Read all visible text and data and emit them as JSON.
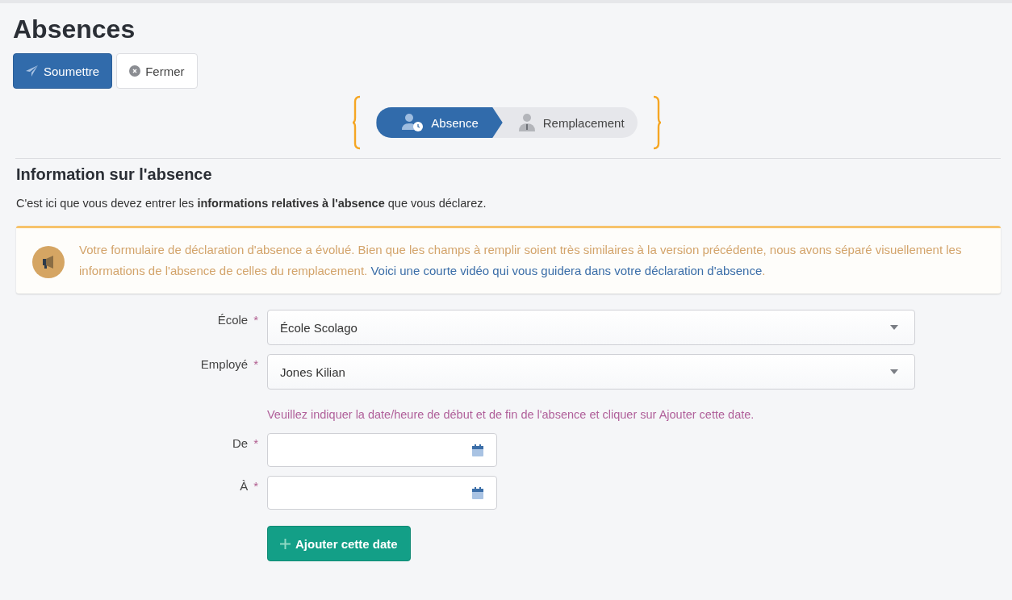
{
  "page": {
    "title": "Absences"
  },
  "toolbar": [
    {
      "label": "Soumettre",
      "kind": "primary"
    },
    {
      "label": "Fermer",
      "kind": "close"
    }
  ],
  "steps": [
    {
      "label": "Absence",
      "selected": true,
      "kind": "absence"
    },
    {
      "label": "Remplacement",
      "selected": false,
      "kind": "replacement"
    }
  ],
  "section": {
    "heading": "Information sur l'absence",
    "description": "C'est ici que vous devez entrer les **informations relatives à l'absence** que vous déclarez."
  },
  "notice": {
    "text": "Votre formulaire de déclaration d'absence a évolué. Bien que les champs à remplir soient très similaires à la version précédente, nous avons séparé visuellement les informations de l'absence de celles du remplacement.",
    "link": "Voici une courte vidéo qui vous guidera dans votre déclaration d'absence",
    "end": "."
  },
  "form": {
    "fields": [
      {
        "label": "École",
        "required_mark": "*",
        "kind": "select",
        "value": "École Scolago"
      },
      {
        "label": "Employé",
        "required_mark": "*",
        "kind": "select",
        "value": "Jones Kilian"
      }
    ],
    "hint": "Veuillez indiquer la date/heure de début et de fin de l'absence et cliquer sur Ajouter cette date.",
    "date_fields": [
      {
        "label": "De",
        "required_mark": "*",
        "kind": "date"
      },
      {
        "label": "À",
        "required_mark": "*",
        "kind": "date"
      }
    ],
    "add_button": "Ajouter cette date"
  }
}
